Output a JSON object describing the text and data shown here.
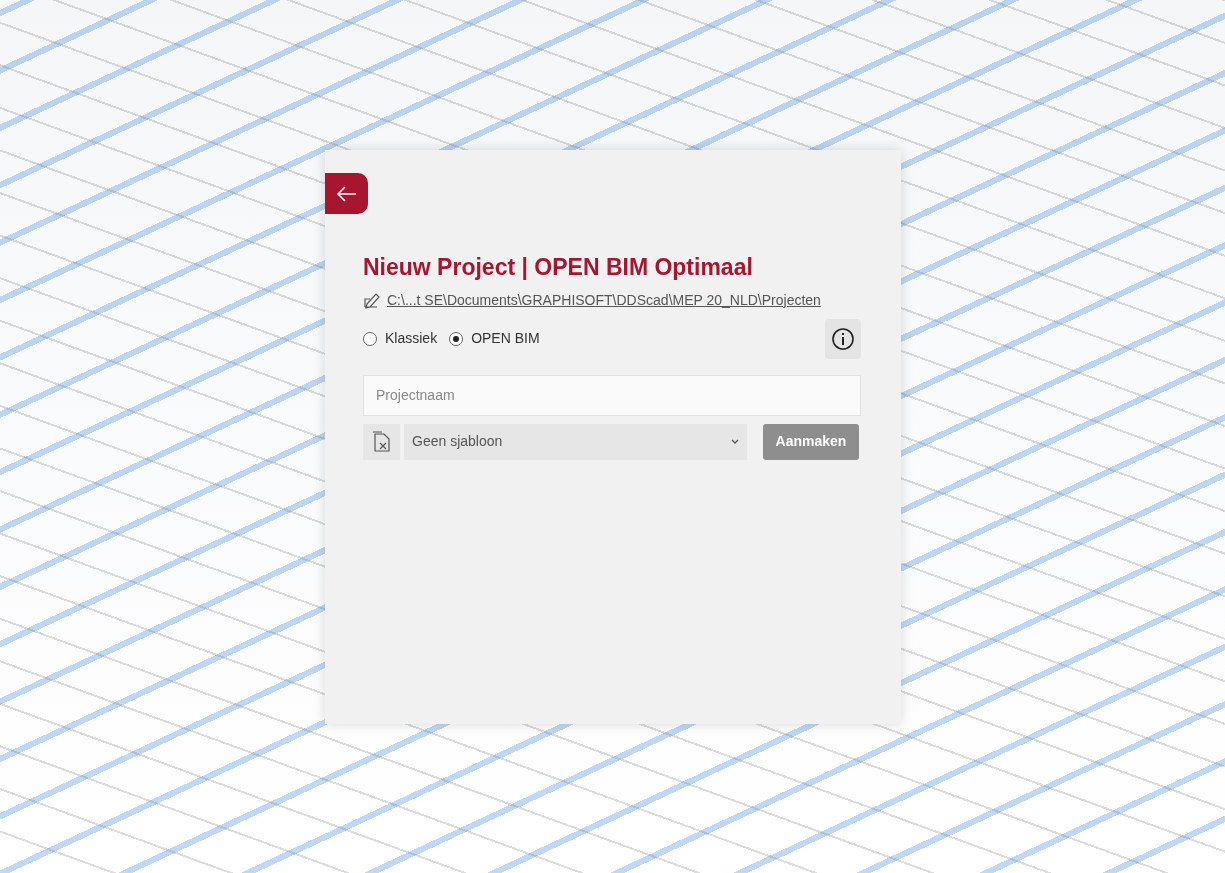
{
  "dialog": {
    "title": "Nieuw Project | OPEN BIM Optimaal",
    "path": "C:\\...t SE\\Documents\\GRAPHISOFT\\DDScad\\MEP 20_NLD\\Projecten",
    "modes": [
      {
        "label": "Klassiek",
        "selected": false
      },
      {
        "label": "OPEN BIM",
        "selected": true
      }
    ],
    "name_field": {
      "placeholder": "Projectnaam"
    },
    "template_select": {
      "value": "Geen sjabloon"
    },
    "create_button": {
      "label": "Aanmaken",
      "disabled": true
    }
  }
}
